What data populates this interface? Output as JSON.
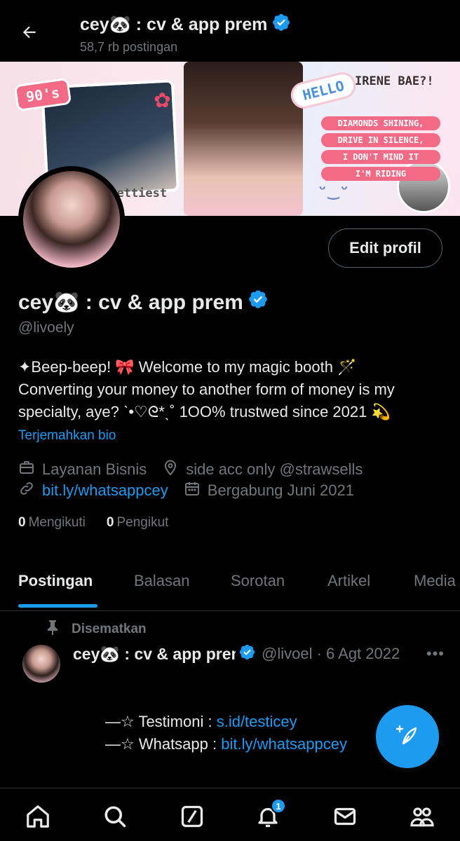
{
  "header": {
    "title": "cey🐼 : cv & app prem",
    "post_count": "58,7 rb postingan"
  },
  "banner": {
    "stickers": {
      "nineties": "90's",
      "hello": "HELLO",
      "irene": "IRENE BAE?!",
      "prettiest": "prettiest",
      "lyrics": [
        "DIAMONDS SHINING,",
        "DRIVE IN SILENCE,",
        "I DON'T MIND IT",
        "I'M RIDING"
      ]
    }
  },
  "profile": {
    "edit_label": "Edit profil",
    "name": "cey🐼 : cv & app prem",
    "handle": "@livoely",
    "bio_lines": [
      "✦Beep-beep! 🎀 Welcome to my magic booth 🪄",
      "Converting your money to another form of money is my",
      "specialty, aye? ˋ•♡ᘓ*ˎ˚ 1OO% trustwed since 2021 💫"
    ],
    "translate_label": "Terjemahkan bio",
    "category": "Layanan Bisnis",
    "location": "side acc only @strawsells",
    "website": "bit.ly/whatsappcey",
    "joined": "Bergabung Juni 2021",
    "following_count": "0",
    "following_label": "Mengikuti",
    "followers_count": "0",
    "followers_label": "Pengikut"
  },
  "tabs": [
    "Postingan",
    "Balasan",
    "Sorotan",
    "Artikel",
    "Media"
  ],
  "pinned_post": {
    "pinned_label": "Disematkan",
    "author_name": "cey🐼 : cv & app prem",
    "meta": "@livoel · 6 Agt 2022",
    "line1_prefix": "—☆ Testimoni : ",
    "line1_link": "s.id/testicey",
    "line2_prefix": "—☆ Whatsapp : ",
    "line2_link": "bit.ly/whatsappcey"
  },
  "bottom_nav": {
    "notification_badge": "1",
    "items": [
      "home-icon",
      "search-icon",
      "grok-icon",
      "bell-icon",
      "mail-icon",
      "communities-icon"
    ]
  },
  "colors": {
    "accent": "#1d9bf0",
    "muted": "#71767b",
    "background": "#000000"
  }
}
